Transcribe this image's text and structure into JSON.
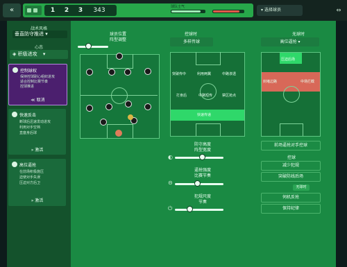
{
  "topbar": {
    "back_icon": "«",
    "tabs": [
      "1",
      "2",
      "3"
    ],
    "count": "343",
    "bar_label": "球队士气",
    "dropdown_label": "选择球员",
    "corner_icon": "⇔"
  },
  "sidebar": {
    "section_title": "战术风格",
    "style_select": "垂直防守推进",
    "scheme_label": "心态",
    "scheme_select": "积极进攻",
    "cards": [
      {
        "title": "控制球权",
        "lines": [
          "保持控球耐心组织进攻",
          "适合控制比赛节奏",
          "控球推进"
        ],
        "action": "取消",
        "action_icon": "≪"
      },
      {
        "title": "快速反击",
        "lines": [
          "断球后迅速发动进攻",
          "利用对手空档",
          "直塞身后球"
        ],
        "action": "激活",
        "action_icon": "»"
      },
      {
        "title": "高位逼抢",
        "lines": [
          "在前场积极施压",
          "迫使对手失误",
          "压迫对方后卫"
        ],
        "action": "激活",
        "action_icon": "»"
      }
    ]
  },
  "formation": {
    "label1": "球员位置",
    "label2": "阵型调整",
    "slider_value": 0.35
  },
  "in_possession": {
    "title": "控球时",
    "select": "多样传球",
    "zones": [
      "突破传中",
      "利用两翼",
      "中路渗透",
      "打身后",
      "中路短传",
      "禁区抢点",
      "快速传递"
    ]
  },
  "out_possession": {
    "title": "无球时",
    "select": "高位逼抢",
    "zones": [
      "压迫后场",
      "封堵边路",
      "中场拦截"
    ],
    "button": "前场逼抢对手控球"
  },
  "sliders": [
    {
      "label1": "防守高度",
      "label2": "阵型宽度",
      "value": 0.55,
      "icon": "◐"
    },
    {
      "label1": "逼抢强度",
      "label2": "比赛节奏",
      "value": 0.45,
      "icon": "⊝"
    },
    {
      "label1": "犯规尺度",
      "label2": "节奏",
      "value": 0.3,
      "icon": "⏻"
    }
  ],
  "right_buttons": {
    "label_top": "控球",
    "btn1": "减少犯规",
    "btn2": "突破防线后场",
    "label_mid": "无球时",
    "btn3": "伺机反抢",
    "btn4": "保持纪律"
  },
  "colors": {
    "accent": "#27a84a",
    "danger": "#e05a4a",
    "highlight": "#2fd86a"
  }
}
